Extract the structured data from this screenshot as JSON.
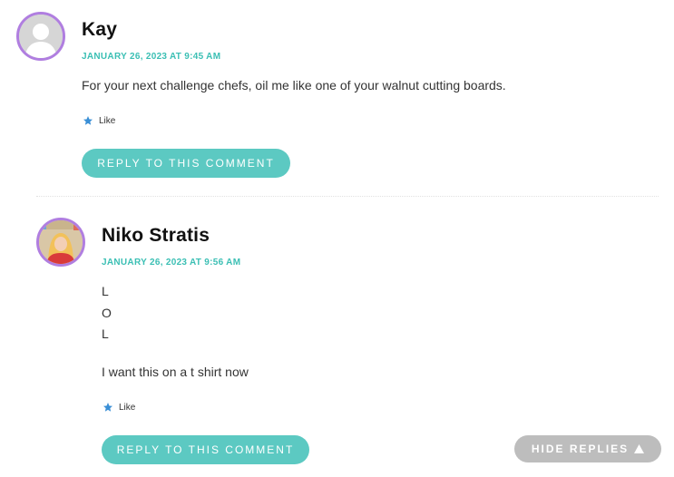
{
  "comments": [
    {
      "author": "Kay",
      "date": "JANUARY 26, 2023 AT 9:45 AM",
      "body": "For your next challenge chefs, oil me like one of your walnut cutting boards.",
      "like_label": "Like",
      "reply_label": "REPLY TO THIS COMMENT",
      "avatar_icon": "default-avatar-icon"
    },
    {
      "author": "Niko Stratis",
      "date": "JANUARY 26, 2023 AT 9:56 AM",
      "body_lines": [
        "L",
        "O",
        "L"
      ],
      "body_paragraph": "I want this on a t shirt now",
      "like_label": "Like",
      "reply_label": "REPLY TO THIS COMMENT",
      "avatar_icon": "user-photo-avatar"
    }
  ],
  "hide_replies_label": "HIDE REPLIES",
  "colors": {
    "accent": "#3bbfb4",
    "button": "#5cc9c2",
    "avatar_ring": "#b07ee0",
    "like_star": "#3a8fd6",
    "hide_button": "#bdbdbd"
  }
}
